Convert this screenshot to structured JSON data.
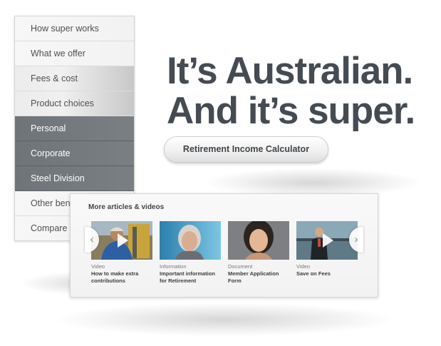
{
  "sidebar": {
    "items": [
      {
        "label": "How super works"
      },
      {
        "label": "What we offer"
      },
      {
        "label": "Fees & cost"
      },
      {
        "label": "Product choices"
      },
      {
        "label": "Personal"
      },
      {
        "label": "Corporate"
      },
      {
        "label": "Steel Division"
      },
      {
        "label": "Other ben"
      },
      {
        "label": "Compare"
      }
    ]
  },
  "hero": {
    "line1": "It’s Australian.",
    "line2": "And it’s super."
  },
  "calculator_button": {
    "label": "Retirement Income Calculator"
  },
  "articles": {
    "title": "More articles & videos",
    "prev_icon": "‹",
    "next_icon": "›",
    "cards": [
      {
        "type": "Video",
        "title": "How to make extra contributions",
        "thumb_icon": "worker-photo"
      },
      {
        "type": "Information",
        "title": "Important information for Retirement",
        "thumb_icon": "elderly-woman-photo"
      },
      {
        "type": "Document",
        "title": "Member Application Form",
        "thumb_icon": "young-woman-photo"
      },
      {
        "type": "Video",
        "title": "Save on Fees",
        "thumb_icon": "businessman-photo"
      }
    ]
  },
  "colors": {
    "hero_text": "#454b52",
    "nav_active_bg": "#737879",
    "panel_bg": "#f5f5f5"
  }
}
